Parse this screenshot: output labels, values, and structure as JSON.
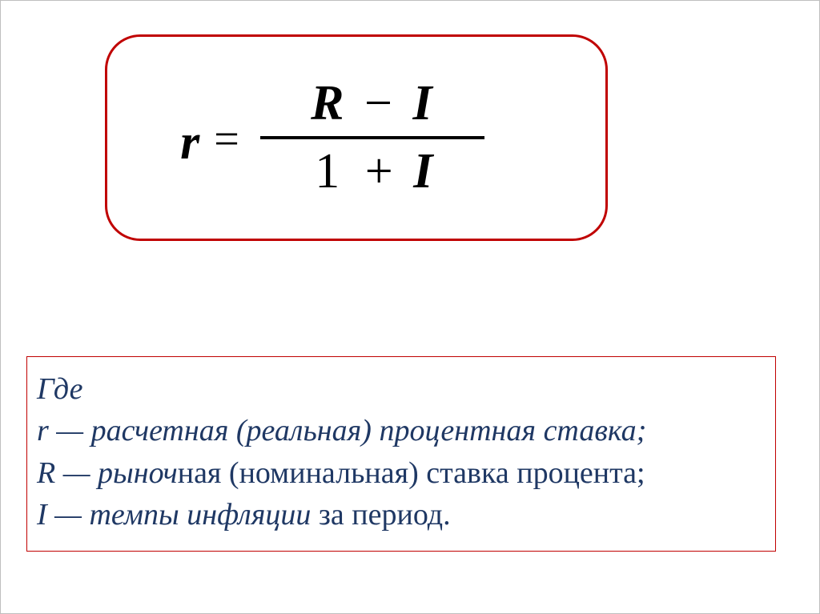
{
  "formula": {
    "lhs": "r",
    "eq": "=",
    "numerator_left": "R",
    "numerator_op": "−",
    "numerator_right": "I",
    "denominator_left": "1",
    "denominator_op": "+",
    "denominator_right": "I"
  },
  "legend": {
    "where": "Где",
    "line1_var": " r — ",
    "line1_desc": "расчетная (реальная) процентная ставка;",
    "line2_var": "R — рыноч",
    "line2_desc": "ная (номинальная) ставка процента;",
    "line3_var": " I — темпы инфляции",
    "line3_desc": " за период."
  }
}
